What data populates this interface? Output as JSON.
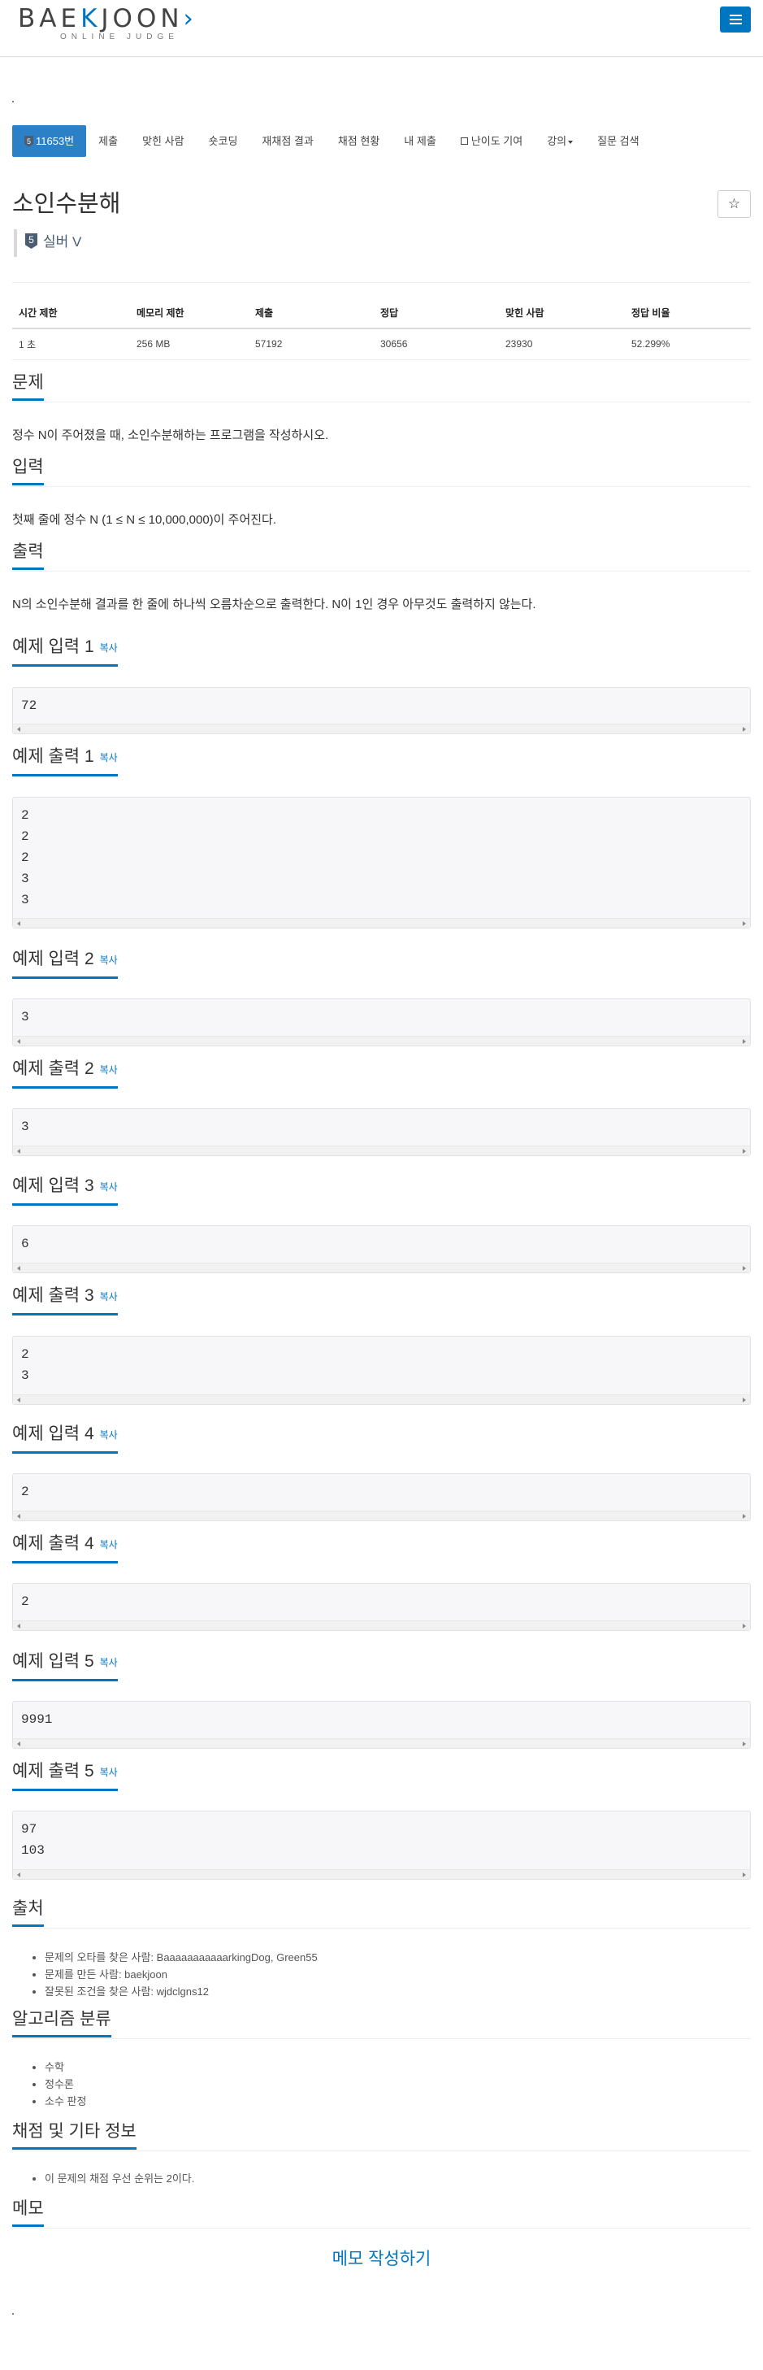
{
  "logo": {
    "prefix": "BAE",
    "k": "K",
    "suffix": "JOON",
    "chevron": "›",
    "subtitle": "ONLINE JUDGE"
  },
  "header": {
    "menu_icon": "hamburger-menu-icon",
    "accent": "#0076c0"
  },
  "tabs": [
    {
      "label": "11653번",
      "tier_num": "5",
      "active": true
    },
    {
      "label": "제출"
    },
    {
      "label": "맞힌 사람"
    },
    {
      "label": "숏코딩"
    },
    {
      "label": "재채점 결과"
    },
    {
      "label": "채점 현황"
    },
    {
      "label": "내 제출"
    },
    {
      "label": "난이도 기여",
      "icon": "external-link-icon"
    },
    {
      "label": "강의",
      "dropdown": true
    },
    {
      "label": "질문 검색"
    }
  ],
  "problem": {
    "title": "소인수분해",
    "star": "☆",
    "tier_badge": "5",
    "tier": "실버 V"
  },
  "info": {
    "headers": [
      "시간 제한",
      "메모리 제한",
      "제출",
      "정답",
      "맞힌 사람",
      "정답 비율"
    ],
    "values": [
      "1 초",
      "256 MB",
      "57192",
      "30656",
      "23930",
      "52.299%"
    ]
  },
  "sections": {
    "problem_heading": "문제",
    "problem_text": "정수 N이 주어졌을 때, 소인수분해하는 프로그램을 작성하시오.",
    "input_heading": "입력",
    "input_text": "첫째 줄에 정수 N (1 ≤ N ≤ 10,000,000)이 주어진다.",
    "output_heading": "출력",
    "output_text": "N의 소인수분해 결과를 한 줄에 하나씩 오름차순으로 출력한다. N이 1인 경우 아무것도 출력하지 않는다."
  },
  "copy_label": "복사",
  "samples": [
    {
      "title": "예제 입력 1",
      "content": "72"
    },
    {
      "title": "예제 출력 1",
      "content": "2\n2\n2\n3\n3"
    },
    {
      "title": "예제 입력 2",
      "content": "3"
    },
    {
      "title": "예제 출력 2",
      "content": "3"
    },
    {
      "title": "예제 입력 3",
      "content": "6"
    },
    {
      "title": "예제 출력 3",
      "content": "2\n3"
    },
    {
      "title": "예제 입력 4",
      "content": "2"
    },
    {
      "title": "예제 출력 4",
      "content": "2"
    },
    {
      "title": "예제 입력 5",
      "content": "9991"
    },
    {
      "title": "예제 출력 5",
      "content": "97\n103"
    }
  ],
  "source": {
    "heading": "출처",
    "items": [
      "문제의 오타를 찾은 사람: BaaaaaaaaaaarkingDog, Green55",
      "문제를 만든 사람: baekjoon",
      "잘못된 조건을 찾은 사람: wjdclgns12"
    ]
  },
  "algorithm": {
    "heading": "알고리즘 분류",
    "items": [
      "수학",
      "정수론",
      "소수 판정"
    ]
  },
  "judge_info": {
    "heading": "채점 및 기타 정보",
    "items": [
      "이 문제의 채점 우선 순위는 2이다."
    ]
  },
  "memo": {
    "heading": "메모",
    "write_label": "메모 작성하기"
  }
}
